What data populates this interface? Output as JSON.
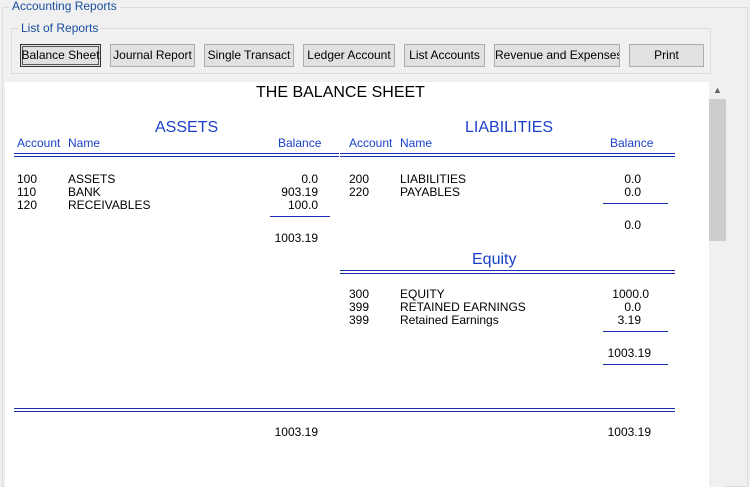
{
  "group": {
    "outer_title": "Accounting Reports",
    "list_title": "List of Reports"
  },
  "buttons": [
    {
      "label": "Balance Sheet"
    },
    {
      "label": "Journal Report"
    },
    {
      "label": "Single Transact"
    },
    {
      "label": "Ledger Account"
    },
    {
      "label": "List Accounts"
    },
    {
      "label": "Revenue and Expenses"
    },
    {
      "label": "Print"
    }
  ],
  "report": {
    "title": "THE BALANCE SHEET",
    "assets": {
      "heading": "ASSETS",
      "col_account": "Account",
      "col_name": "Name",
      "col_balance": "Balance",
      "rows": [
        {
          "account": "100",
          "name": "ASSETS",
          "balance": "0.0"
        },
        {
          "account": "110",
          "name": "BANK",
          "balance": "903.19"
        },
        {
          "account": "120",
          "name": "RECEIVABLES",
          "balance": "100.0"
        }
      ],
      "subtotal": "1003.19"
    },
    "liabilities": {
      "heading": "LIABILITIES",
      "col_account": "Account",
      "col_name": "Name",
      "col_balance": "Balance",
      "rows": [
        {
          "account": "200",
          "name": "LIABILITIES",
          "balance": "0.0"
        },
        {
          "account": "220",
          "name": "PAYABLES",
          "balance": "0.0"
        }
      ],
      "subtotal": "0.0"
    },
    "equity": {
      "heading": "Equity",
      "rows": [
        {
          "account": "300",
          "name": "EQUITY",
          "balance": "1000.0"
        },
        {
          "account": "399",
          "name": "RETAINED EARNINGS",
          "balance": "0.0"
        },
        {
          "account": "399",
          "name": "Retained Earnings",
          "balance": "3.19"
        }
      ],
      "subtotal": "1003.19"
    },
    "totals": {
      "assets": "1003.19",
      "liabilities_equity": "1003.19"
    }
  }
}
